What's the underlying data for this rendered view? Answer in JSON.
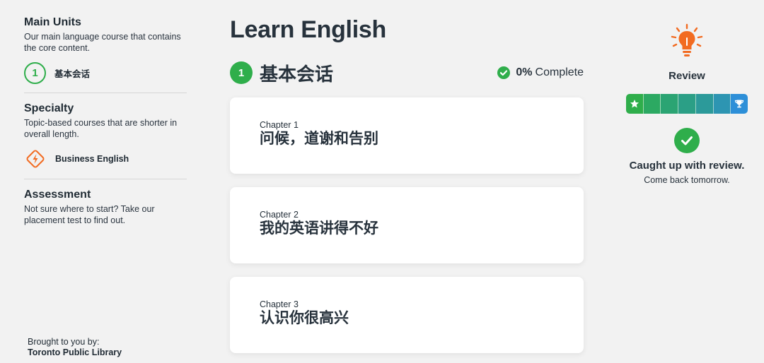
{
  "sidebar": {
    "main_units": {
      "title": "Main Units",
      "description": "Our main language course that contains the core content.",
      "items": [
        {
          "number": "1",
          "label": "基本会话"
        }
      ]
    },
    "specialty": {
      "title": "Specialty",
      "description": "Topic-based courses that are shorter in overall length.",
      "items": [
        {
          "icon": "lightning-diamond-icon",
          "label": "Business English"
        }
      ]
    },
    "assessment": {
      "title": "Assessment",
      "description": "Not sure where to start? Take our placement test to find out."
    },
    "footer": {
      "line1": "Brought to you by:",
      "org": "Toronto Public Library"
    }
  },
  "main": {
    "title": "Learn English",
    "unit": {
      "number": "1",
      "title": "基本会话",
      "progress_percent": "0%",
      "progress_label": "Complete"
    },
    "chapters": [
      {
        "number": "Chapter 1",
        "title": "问候，道谢和告别"
      },
      {
        "number": "Chapter 2",
        "title": "我的英语讲得不好"
      },
      {
        "number": "Chapter 3",
        "title": "认识你很高兴"
      }
    ]
  },
  "review": {
    "title": "Review",
    "segments": 7,
    "status_title": "Caught up with review.",
    "status_sub": "Come back tomorrow."
  },
  "colors": {
    "green": "#2fae4b",
    "orange": "#f26b21",
    "blue": "#2d8fd8"
  }
}
